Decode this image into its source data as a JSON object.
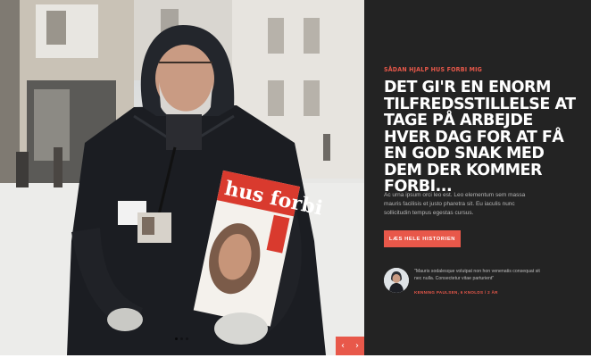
{
  "hero": {
    "eyebrow": "SÅDAN HJALP HUS FORBI MIG",
    "headline": "DET GI'R EN ENORM TILFREDSSTILLELSE AT TAGE PÅ ARBEJDE HVER DAG FOR AT FÅ EN GOD SNAK MED DEM DER KOMMER FORBI...",
    "body": "Ac urna ipsum orci leo est. Leo elementum sem massa mauris facilisis et justo pharetra sit. Eu iaculis nunc sollicitudin tempus egestas cursus.",
    "cta_label": "LÆS HELE HISTORIEN"
  },
  "testimonial": {
    "quote": "\"Mauris sodalesque volutpat non hon venenatis consequat sit nec nulla. Consectetur vitae parturient\"",
    "author": "KENNING PAULSEN, 6 KNOLDS / 2 ÅR"
  },
  "photo": {
    "magazine_title": "hus forbi"
  },
  "slider": {
    "prev_label": "‹",
    "next_label": "›"
  },
  "colors": {
    "accent": "#e8584a",
    "panel": "#232323"
  }
}
